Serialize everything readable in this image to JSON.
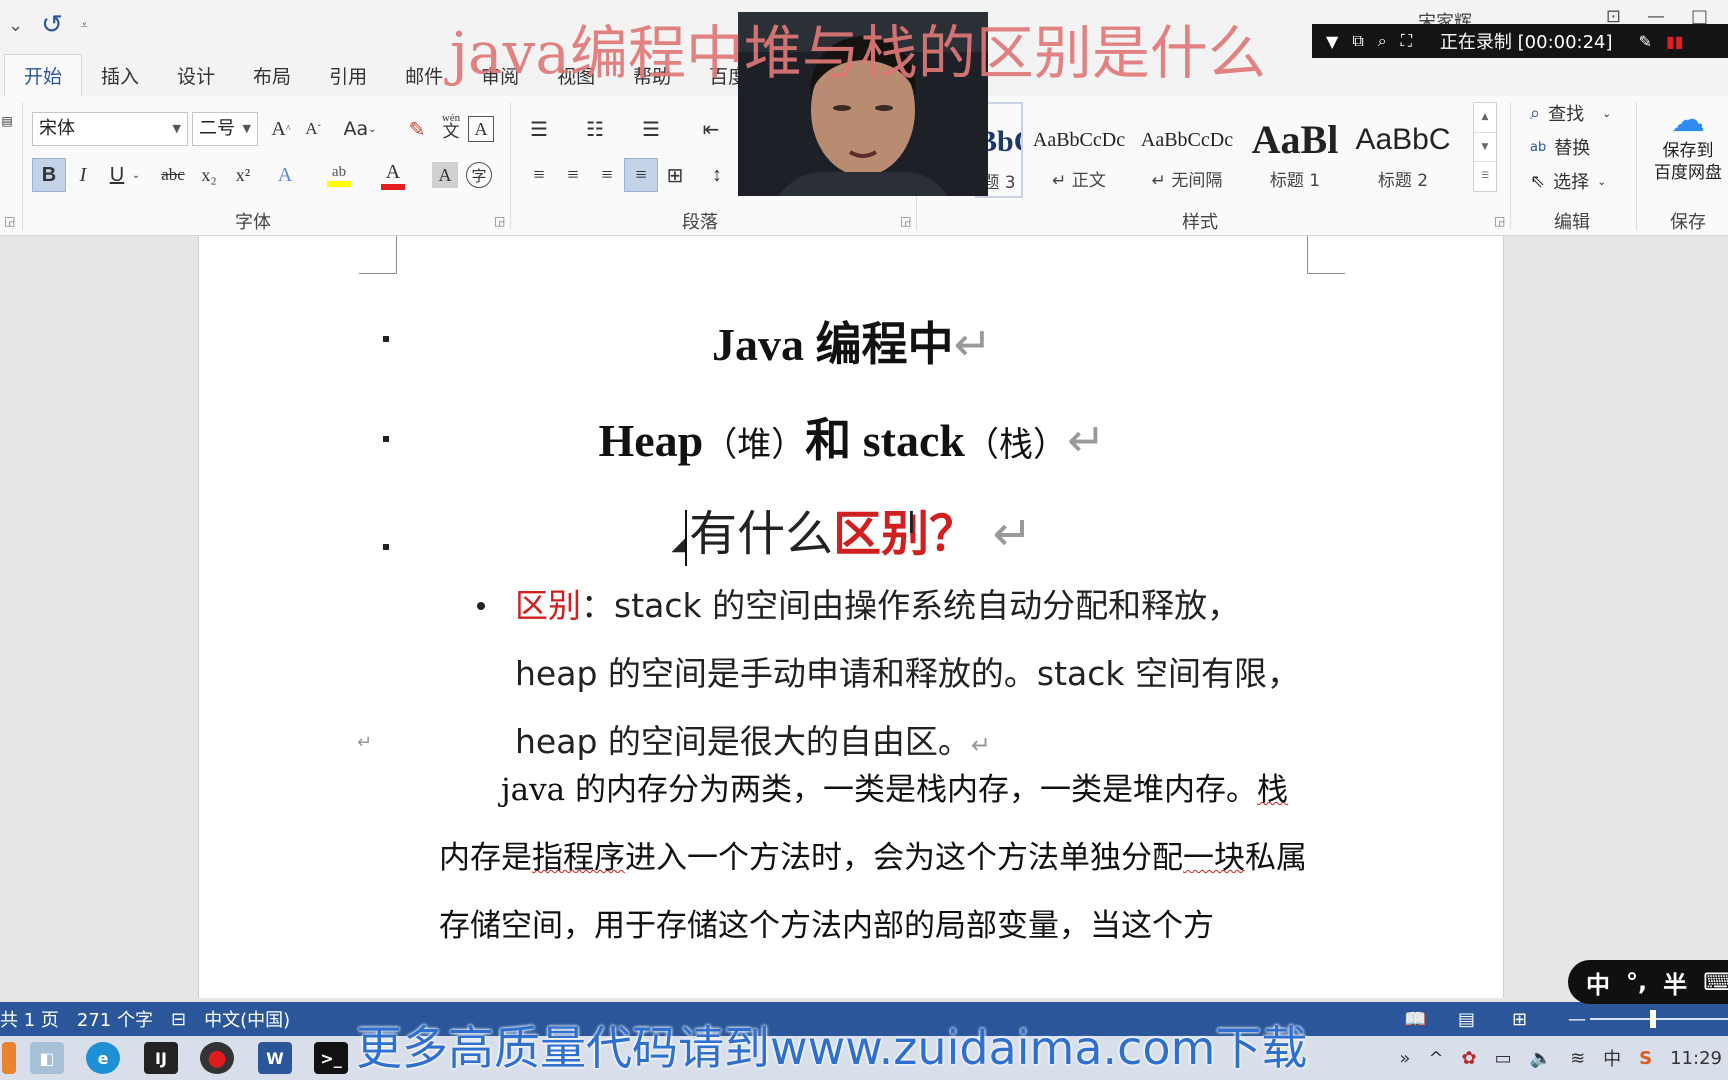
{
  "qat": {
    "undo_glyph": "⌄",
    "redo_glyph": "↺",
    "customize_glyph": "⩡"
  },
  "tabs": [
    "开始",
    "插入",
    "设计",
    "布局",
    "引用",
    "邮件",
    "审阅",
    "视图",
    "帮助",
    "百度网"
  ],
  "user_name": "宋家辉",
  "font": {
    "group_label": "字体",
    "name": "宋体",
    "size": "二号",
    "grow": "A",
    "shrink": "A",
    "case": "Aa",
    "bold": "B",
    "italic": "I",
    "underline": "U",
    "strike": "abc",
    "subscript": "x₂",
    "superscript": "x²",
    "effects": "A",
    "highlight": "ab",
    "color": "A",
    "shading": "A",
    "enclose": "字",
    "phonetic": "wén",
    "border_char": "A"
  },
  "paragraph": {
    "group_label": "段落"
  },
  "styles": {
    "group_label": "样式",
    "items": [
      {
        "preview": "BbC",
        "name": "题 3"
      },
      {
        "preview": "AaBbCcDc",
        "name": "↵ 正文"
      },
      {
        "preview": "AaBbCcDc",
        "name": "↵ 无间隔"
      },
      {
        "preview": "AaBl",
        "name": "标题 1"
      },
      {
        "preview": "AaBbC",
        "name": "标题 2"
      }
    ]
  },
  "editing": {
    "group_label": "编辑",
    "find": "查找",
    "replace": "替换",
    "select": "选择"
  },
  "save": {
    "group_label": "保存",
    "label": "保存到\n百度网盘",
    "line1": "保存到",
    "line2": "百度网盘"
  },
  "document": {
    "title_line1": "Java 编程中",
    "title_line2_a": "Heap",
    "title_line2_b": "（堆）",
    "title_line2_c": "和",
    "title_line2_d": "stack",
    "title_line2_e": "（栈）",
    "title_line3_a": "有什么",
    "title_line3_b": "区别？",
    "para_mark": "↵",
    "bullet_label": "区别",
    "bullet_text": "：stack 的空间由操作系统自动分配和释放，heap 的空间是手动申请和释放的。stack 空间有限，heap 的空间是很大的自由区。",
    "para_a": "java 的内存分为两类，一类是栈内存，一类是堆内存。",
    "para_b": "栈",
    "para_c": "内存是",
    "para_d": "指程序",
    "para_e": "进入一个方法时，会为这个方法单独分配",
    "para_f": "一块",
    "para_g": "私属存储空间，用于存储这个方法内部的局部变量，当这个方"
  },
  "status": {
    "page": "共 1 页",
    "words": "271 个字",
    "language": "中文(中国)"
  },
  "overlays": {
    "video_title": "java编程中堆与栈的区别是什么",
    "recording": "正在录制 [00:00:24]",
    "ime": [
      "中",
      "°,",
      "半",
      "⌨"
    ],
    "watermark": "更多高质量代码请到www.zuidaima.com下载"
  },
  "taskbar": {
    "clock": "11:29",
    "ime_zh": "中"
  },
  "colors": {
    "accent": "#2b579a",
    "doc_red": "#d01f1f",
    "watermark": "#2f6fd0",
    "title_overlay": "#e07878"
  }
}
